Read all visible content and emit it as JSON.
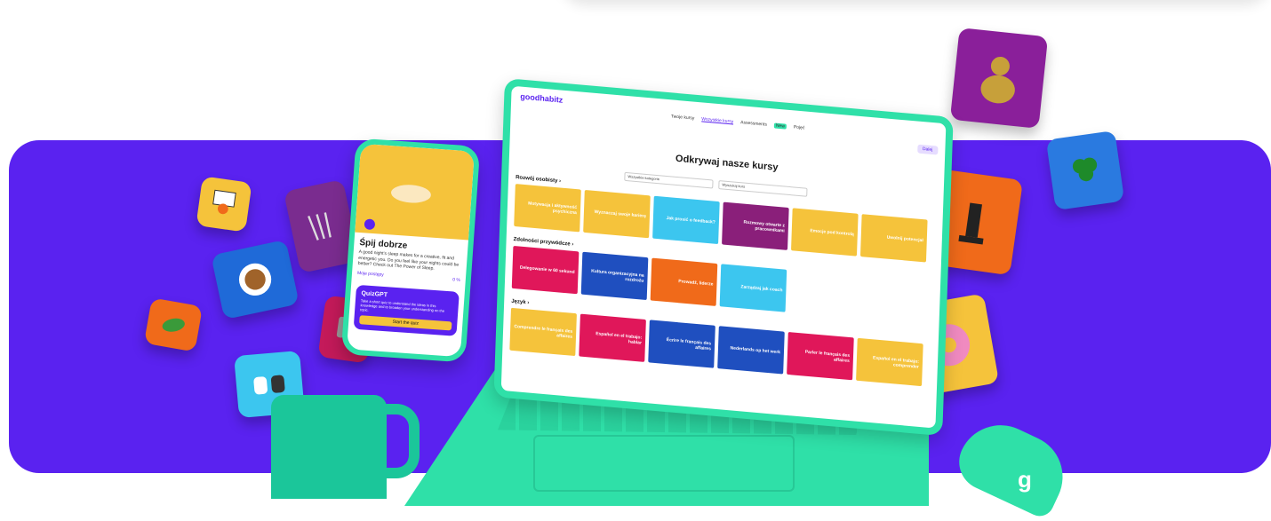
{
  "colors": {
    "purple": "#5a22f0",
    "green": "#2fe0a8",
    "yellow": "#f5c33b"
  },
  "phone": {
    "title": "Śpij dobrze",
    "description": "A good night's sleep makes for a creative, fit and energetic you. Do you feel like your nights could be better? Check out The Power of Sleep.",
    "progress_label": "Moje postępy",
    "progress_value": "0 %",
    "quiz_title": "QuizGPT",
    "quiz_desc": "Take a short quiz to understand the ideas in this knowledge and to broaden your understanding on the topic.",
    "quiz_button": "Start the quiz"
  },
  "laptop": {
    "logo": "goodhabitz",
    "nav": [
      "Twoje kursy",
      "Wszystkie kursy",
      "Assessments",
      "Pojęć"
    ],
    "nav_badge": "New",
    "login": "Dalej",
    "hero_title": "Odkrywaj nasze kursy",
    "filter_category": "Wszystkie kategorie",
    "search_placeholder": "Wyszukaj kurs",
    "sections": [
      {
        "title": "Rozwój osobisty ›",
        "tiles": [
          {
            "label": "Motywacja i aktywność psychiczna",
            "color": "#f5c33b"
          },
          {
            "label": "Wyznaczaj swoje karierę",
            "color": "#f5c33b"
          },
          {
            "label": "Jak prosić o feedback?",
            "color": "#3cc6ef"
          },
          {
            "label": "Rozmowy otwarte z pracownikami",
            "color": "#8a1f7a"
          },
          {
            "label": "Emocje pod kontrolą",
            "color": "#f5c33b"
          },
          {
            "label": "Uwolnij potencjał",
            "color": "#f5c33b"
          }
        ]
      },
      {
        "title": "Zdolności przywódcze ›",
        "tiles": [
          {
            "label": "Delegowanie w 60 sekund",
            "color": "#e0175a"
          },
          {
            "label": "Kultura organizacyjna na rozdrożu",
            "color": "#1f4fbf"
          },
          {
            "label": "Prowadź, liderze",
            "color": "#f06a1a"
          },
          {
            "label": "Zarządzaj jak coach",
            "color": "#3cc6ef"
          }
        ]
      },
      {
        "title": "Język ›",
        "tiles": [
          {
            "label": "Comprendre le français des affaires",
            "color": "#f5c33b"
          },
          {
            "label": "Español en el trabajo: hablar",
            "color": "#e0175a"
          },
          {
            "label": "Écrire le français des affaires",
            "color": "#1f4fbf"
          },
          {
            "label": "Nederlands op het werk",
            "color": "#1f4fbf"
          },
          {
            "label": "Parler le français des affaires",
            "color": "#e0175a"
          },
          {
            "label": "Español en el trabajo: comprender",
            "color": "#f5c33b"
          }
        ]
      }
    ]
  }
}
